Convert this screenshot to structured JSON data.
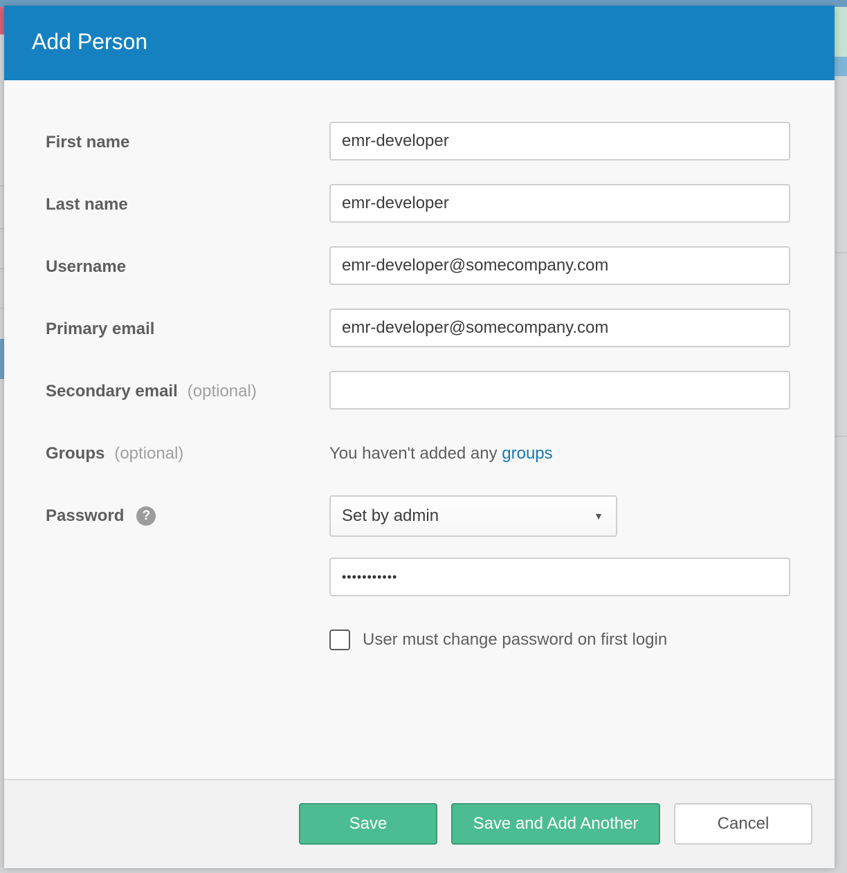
{
  "modal": {
    "title": "Add Person"
  },
  "form": {
    "first_name": {
      "label": "First name",
      "value": "emr-developer"
    },
    "last_name": {
      "label": "Last name",
      "value": "emr-developer"
    },
    "username": {
      "label": "Username",
      "value": "emr-developer@somecompany.com"
    },
    "primary_email": {
      "label": "Primary email",
      "value": "emr-developer@somecompany.com"
    },
    "secondary_email": {
      "label": "Secondary email",
      "optional": "(optional)",
      "value": ""
    },
    "groups": {
      "label": "Groups",
      "optional": "(optional)",
      "empty_text": "You haven't added any ",
      "link": "groups"
    },
    "password": {
      "label": "Password",
      "help_icon": "question-icon",
      "help_glyph": "?",
      "mode_selected": "Set by admin",
      "caret": "▼",
      "masked_value": "•••••••••••"
    },
    "must_change_password": {
      "label": "User must change password on first login",
      "checked": false
    }
  },
  "footer": {
    "save_label": "Save",
    "save_another_label": "Save and Add Another",
    "cancel_label": "Cancel"
  },
  "colors": {
    "header": "#1681c1",
    "primary_button": "#4cbc93",
    "link": "#1678b4"
  }
}
